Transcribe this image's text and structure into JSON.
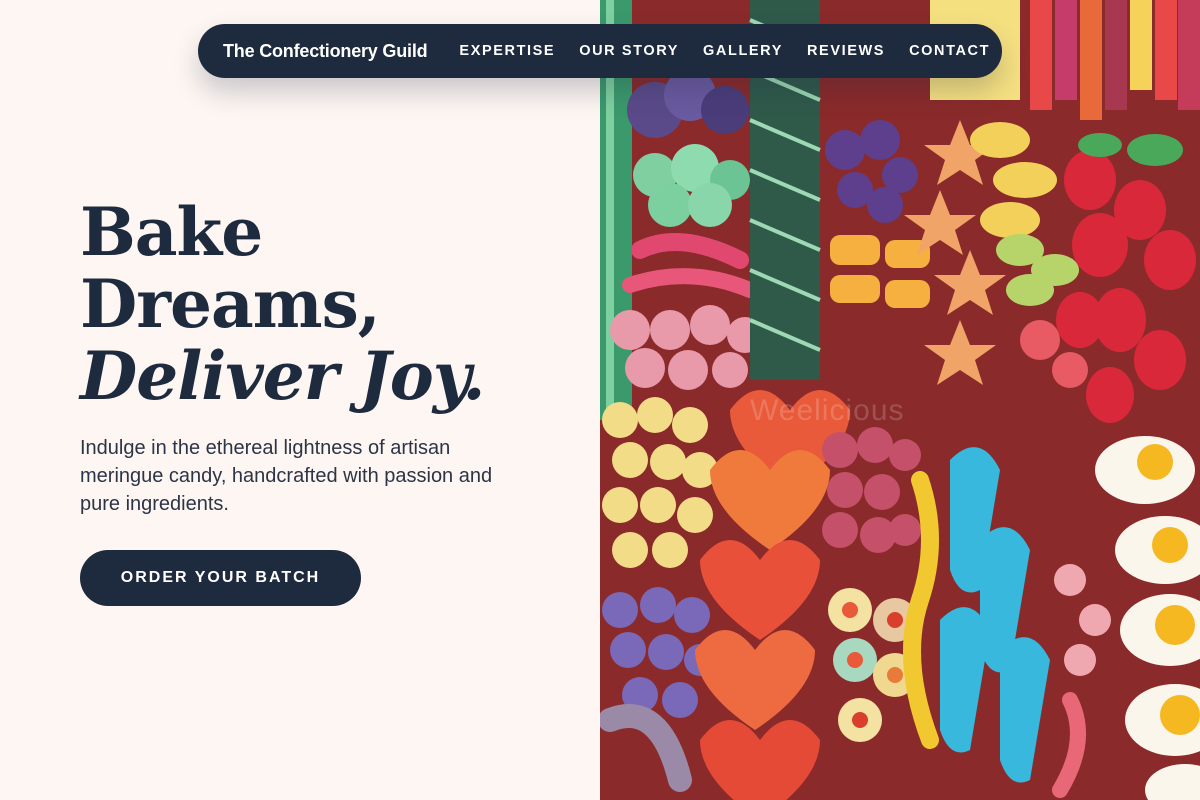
{
  "nav": {
    "brand": "The Confectionery Guild",
    "links": [
      "EXPERTISE",
      "OUR STORY",
      "GALLERY",
      "REVIEWS",
      "CONTACT"
    ]
  },
  "hero": {
    "title_line1": "Bake",
    "title_line2": "Dreams,",
    "title_line3": "Deliver Joy.",
    "subtitle": "Indulge in the ethereal lightness of artisan meringue candy, handcrafted with passion and pure ingredients.",
    "cta_label": "ORDER YOUR BATCH"
  },
  "image": {
    "alt": "Assorted colorful gummy candies",
    "watermark": "Weelicious"
  },
  "colors": {
    "navy": "#1e2a3e",
    "background": "#fdf6f2"
  }
}
